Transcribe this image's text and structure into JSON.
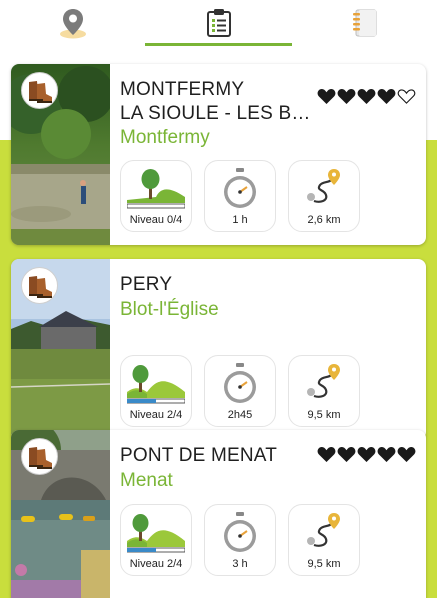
{
  "tabs": [
    {
      "name": "map",
      "icon": "map-pin-icon"
    },
    {
      "name": "list",
      "icon": "clipboard-list-icon",
      "active": true
    },
    {
      "name": "notebook",
      "icon": "notebook-icon"
    }
  ],
  "colors": {
    "accent": "#7ab536",
    "background_band": "#c9de3d",
    "hearts": "#1a1a1a"
  },
  "cards": [
    {
      "title_line1": "MONTFERMY",
      "title_line2": "LA SIOULE - LES BA...",
      "place": "Montfermy",
      "hearts_filled": 4,
      "hearts_total": 5,
      "level": "Niveau 0/4",
      "level_value": 0,
      "duration": "1 h",
      "distance": "2,6 km"
    },
    {
      "title_line1": "PERY",
      "place": "Blot-l'Église",
      "level": "Niveau 2/4",
      "level_value": 2,
      "duration": "2h45",
      "distance": "9,5 km"
    },
    {
      "title_line1": "PONT DE MENAT",
      "place": "Menat",
      "hearts_filled": 5,
      "hearts_total": 5,
      "level": "Niveau 2/4",
      "level_value": 2,
      "duration": "3 h",
      "distance": "9,5 km"
    }
  ]
}
